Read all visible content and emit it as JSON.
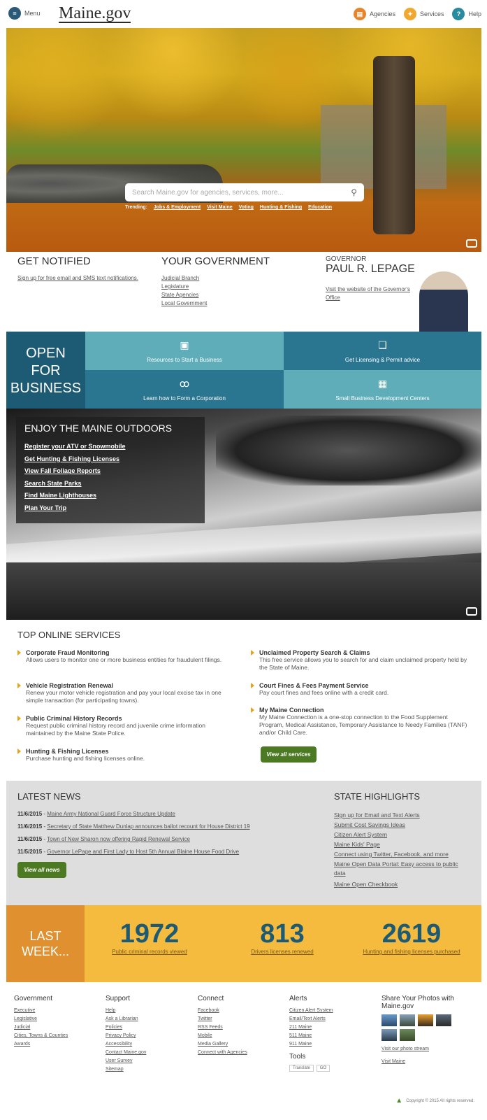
{
  "header": {
    "menu_label": "Menu",
    "logo": "Maine.gov",
    "nav": [
      {
        "label": "Agencies",
        "color": "#e8852a"
      },
      {
        "label": "Services",
        "color": "#f0a830"
      },
      {
        "label": "Help",
        "color": "#2a8aa0"
      }
    ]
  },
  "hero": {
    "search_placeholder": "Search Maine.gov for agencies, services, more...",
    "trending_label": "Trending:",
    "trending": [
      "Jobs & Employment",
      "Visit Maine",
      "Voting",
      "Hunting & Fishing",
      "Education"
    ]
  },
  "notified": {
    "title": "GET NOTIFIED",
    "text": "Sign up for free email and SMS text notifications."
  },
  "your_government": {
    "title": "YOUR GOVERNMENT",
    "links": [
      "Judicial Branch",
      "Legislature",
      "State Agencies",
      "Local Government"
    ]
  },
  "governor": {
    "label": "GOVERNOR",
    "name": "PAUL R. LEPAGE",
    "link": "Visit the website of the Governor's Office"
  },
  "open_for_business": {
    "title_lines": [
      "OPEN",
      "FOR",
      "BUSINESS"
    ],
    "items": [
      {
        "label": "Resources to Start a Business",
        "icon": "clipboard-icon"
      },
      {
        "label": "Get Licensing & Permit advice",
        "icon": "chat-icon"
      },
      {
        "label": "Learn how to Form a Corporation",
        "icon": "people-icon"
      },
      {
        "label": "Small Business Development Centers",
        "icon": "building-icon"
      }
    ]
  },
  "outdoors": {
    "title": "ENJOY THE MAINE OUTDOORS",
    "links": [
      "Register your ATV or Snowmobile",
      "Get Hunting & Fishing Licenses",
      "View Fall Foliage Reports",
      "Search State Parks",
      "Find Maine Lighthouses",
      "Plan Your Trip"
    ]
  },
  "services": {
    "title": "TOP ONLINE SERVICES",
    "left": [
      {
        "title": "Corporate Fraud Monitoring",
        "desc": "Allows users to monitor one or more business entities for fraudulent filings."
      },
      {
        "title": "Vehicle Registration Renewal",
        "desc": "Renew your motor vehicle registration and pay your local excise tax in one simple transaction (for participating towns)."
      },
      {
        "title": "Public Criminal History Records",
        "desc": "Request public criminal history record and juvenile crime information maintained by the Maine State Police."
      },
      {
        "title": "Hunting & Fishing Licenses",
        "desc": "Purchase hunting and fishing licenses online."
      }
    ],
    "right": [
      {
        "title": "Unclaimed Property Search & Claims",
        "desc": "This free service allows you to search for and claim unclaimed property held by the State of Maine."
      },
      {
        "title": "Court Fines & Fees Payment Service",
        "desc": "Pay court fines and fees online with a credit card."
      },
      {
        "title": "My Maine Connection",
        "desc": "My Maine Connection is a one-stop connection to the Food Supplement Program, Medical Assistance, Temporary Assistance to Needy Families (TANF) and/or Child Care."
      }
    ],
    "view_all": "View all services"
  },
  "news": {
    "title": "LATEST NEWS",
    "items": [
      {
        "date": "11/6/2015",
        "text": "Maine Army National Guard Force Structure Update"
      },
      {
        "date": "11/6/2015",
        "text": "Secretary of State Matthew Dunlap announces ballot recount for House District 19"
      },
      {
        "date": "11/6/2015",
        "text": "Town of New Sharon now offering Rapid Renewal Service"
      },
      {
        "date": "11/5/2015",
        "text": "Governor LePage and First Lady to Host 5th Annual Blaine House Food Drive"
      }
    ],
    "view_all": "View all news"
  },
  "highlights": {
    "title": "STATE HIGHLIGHTS",
    "links": [
      "Sign up for Email and Text Alerts",
      "Submit Cost Savings Ideas",
      "Citizen Alert System",
      "Maine Kids' Page",
      "Connect using Twitter, Facebook, and more",
      "Maine Open Data Portal: Easy access to public data",
      "Maine Open Checkbook"
    ]
  },
  "last_week": {
    "title_lines": [
      "LAST",
      "WEEK..."
    ],
    "stats": [
      {
        "number": "1972",
        "label": "Public criminal records viewed"
      },
      {
        "number": "813",
        "label": "Drivers licenses renewed"
      },
      {
        "number": "2619",
        "label": "Hunting and fishing licenses purchased"
      }
    ]
  },
  "footer": {
    "government": {
      "title": "Government",
      "links": [
        "Executive",
        "Legislative",
        "Judicial",
        "Cities, Towns & Counties",
        "Awards"
      ]
    },
    "support": {
      "title": "Support",
      "links": [
        "Help",
        "Ask a Librarian",
        "Policies",
        "Privacy Policy",
        "Accessibility",
        "Contact Maine.gov",
        "User Survey",
        "Sitemap"
      ]
    },
    "connect": {
      "title": "Connect",
      "links": [
        "Facebook",
        "Twitter",
        "RSS Feeds",
        "Mobile",
        "Media Gallery",
        "Connect with Agencies"
      ]
    },
    "alerts": {
      "title": "Alerts",
      "links": [
        "Citizen Alert System",
        "Email/Text Alerts",
        "211 Maine",
        "511 Maine",
        "911 Maine"
      ]
    },
    "tools": {
      "title": "Tools",
      "translate_label": "Translate",
      "go_label": "GO"
    },
    "photos": {
      "title": "Share Your Photos with Maine.gov",
      "view_link": "Visit our photo stream",
      "visit_maine": "Visit Maine"
    },
    "copyright": "Copyright © 2015 All rights reserved."
  }
}
